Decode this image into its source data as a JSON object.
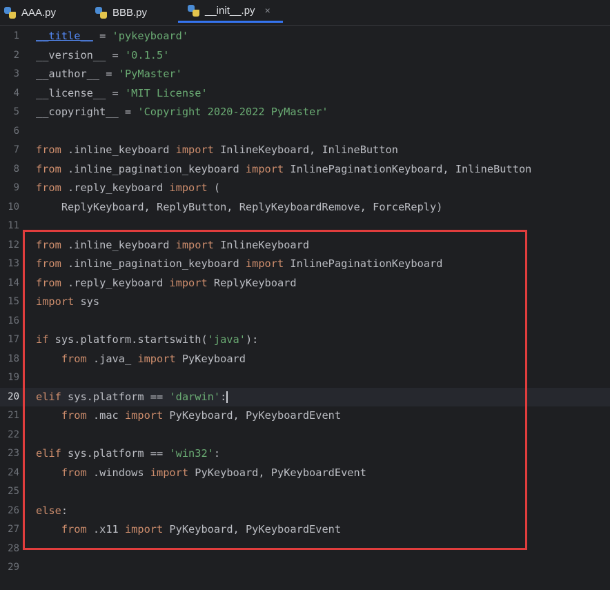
{
  "tabs": [
    {
      "label": "AAA.py",
      "icon": "python-file-icon",
      "active": false
    },
    {
      "label": "BBB.py",
      "icon": "python-file-icon",
      "active": false
    },
    {
      "label": "__init__.py",
      "icon": "python-file-icon",
      "active": true,
      "close": "×"
    }
  ],
  "colors": {
    "keyword": "#cf8e6d",
    "string": "#6aab73",
    "text": "#bcbec4",
    "accent": "#3574f0",
    "annotation": "#e03d3d"
  },
  "current_line": 20,
  "lines": [
    {
      "n": "1",
      "segs": [
        [
          "link",
          "__title__"
        ],
        [
          "t",
          " = "
        ],
        [
          "str",
          "'pykeyboard'"
        ]
      ]
    },
    {
      "n": "2",
      "segs": [
        [
          "t",
          "__version__ = "
        ],
        [
          "str",
          "'0.1.5'"
        ]
      ]
    },
    {
      "n": "3",
      "segs": [
        [
          "t",
          "__author__ = "
        ],
        [
          "str",
          "'PyMaster'"
        ]
      ]
    },
    {
      "n": "4",
      "segs": [
        [
          "t",
          "__license__ = "
        ],
        [
          "str",
          "'MIT License'"
        ]
      ]
    },
    {
      "n": "5",
      "segs": [
        [
          "t",
          "__copyright__ = "
        ],
        [
          "str",
          "'Copyright 2020-2022 PyMaster'"
        ]
      ]
    },
    {
      "n": "6",
      "segs": []
    },
    {
      "n": "7",
      "segs": [
        [
          "kw",
          "from"
        ],
        [
          "t",
          " .inline_keyboard "
        ],
        [
          "kw",
          "import"
        ],
        [
          "t",
          " InlineKeyboard, InlineButton"
        ]
      ]
    },
    {
      "n": "8",
      "segs": [
        [
          "kw",
          "from"
        ],
        [
          "t",
          " .inline_pagination_keyboard "
        ],
        [
          "kw",
          "import"
        ],
        [
          "t",
          " InlinePaginationKeyboard, InlineButton"
        ]
      ]
    },
    {
      "n": "9",
      "segs": [
        [
          "kw",
          "from"
        ],
        [
          "t",
          " .reply_keyboard "
        ],
        [
          "kw",
          "import"
        ],
        [
          "t",
          " ("
        ]
      ]
    },
    {
      "n": "10",
      "segs": [
        [
          "t",
          "    ReplyKeyboard, ReplyButton, ReplyKeyboardRemove, ForceReply)"
        ]
      ]
    },
    {
      "n": "11",
      "segs": []
    },
    {
      "n": "12",
      "segs": [
        [
          "kw",
          "from"
        ],
        [
          "t",
          " .inline_keyboard "
        ],
        [
          "kw",
          "import"
        ],
        [
          "t",
          " InlineKeyboard"
        ]
      ]
    },
    {
      "n": "13",
      "segs": [
        [
          "kw",
          "from"
        ],
        [
          "t",
          " .inline_pagination_keyboard "
        ],
        [
          "kw",
          "import"
        ],
        [
          "t",
          " InlinePaginationKeyboard"
        ]
      ]
    },
    {
      "n": "14",
      "segs": [
        [
          "kw",
          "from"
        ],
        [
          "t",
          " .reply_keyboard "
        ],
        [
          "kw",
          "import"
        ],
        [
          "t",
          " ReplyKeyboard"
        ]
      ]
    },
    {
      "n": "15",
      "segs": [
        [
          "kw",
          "import"
        ],
        [
          "t",
          " sys"
        ]
      ]
    },
    {
      "n": "16",
      "segs": []
    },
    {
      "n": "17",
      "segs": [
        [
          "kw",
          "if"
        ],
        [
          "t",
          " sys.platform.startswith("
        ],
        [
          "str",
          "'java'"
        ],
        [
          "t",
          "):"
        ]
      ]
    },
    {
      "n": "18",
      "segs": [
        [
          "t",
          "    "
        ],
        [
          "kw",
          "from"
        ],
        [
          "t",
          " .java_ "
        ],
        [
          "kw",
          "import"
        ],
        [
          "t",
          " PyKeyboard"
        ]
      ]
    },
    {
      "n": "19",
      "segs": []
    },
    {
      "n": "20",
      "segs": [
        [
          "kw",
          "elif"
        ],
        [
          "t",
          " sys.platform == "
        ],
        [
          "str",
          "'darwin'"
        ],
        [
          "t",
          ":"
        ],
        [
          "caret",
          ""
        ]
      ]
    },
    {
      "n": "21",
      "segs": [
        [
          "t",
          "    "
        ],
        [
          "kw",
          "from"
        ],
        [
          "t",
          " .mac "
        ],
        [
          "kw",
          "import"
        ],
        [
          "t",
          " PyKeyboard, PyKeyboardEvent"
        ]
      ]
    },
    {
      "n": "22",
      "segs": []
    },
    {
      "n": "23",
      "segs": [
        [
          "kw",
          "elif"
        ],
        [
          "t",
          " sys.platform == "
        ],
        [
          "str",
          "'win32'"
        ],
        [
          "t",
          ":"
        ]
      ]
    },
    {
      "n": "24",
      "segs": [
        [
          "t",
          "    "
        ],
        [
          "kw",
          "from"
        ],
        [
          "t",
          " .windows "
        ],
        [
          "kw",
          "import"
        ],
        [
          "t",
          " PyKeyboard, PyKeyboardEvent"
        ]
      ]
    },
    {
      "n": "25",
      "segs": []
    },
    {
      "n": "26",
      "segs": [
        [
          "kw",
          "else"
        ],
        [
          "t",
          ":"
        ]
      ]
    },
    {
      "n": "27",
      "segs": [
        [
          "t",
          "    "
        ],
        [
          "kw",
          "from"
        ],
        [
          "t",
          " .x11 "
        ],
        [
          "kw",
          "import"
        ],
        [
          "t",
          " PyKeyboard, PyKeyboardEvent"
        ]
      ]
    },
    {
      "n": "28",
      "segs": []
    },
    {
      "n": "29",
      "segs": []
    }
  ]
}
